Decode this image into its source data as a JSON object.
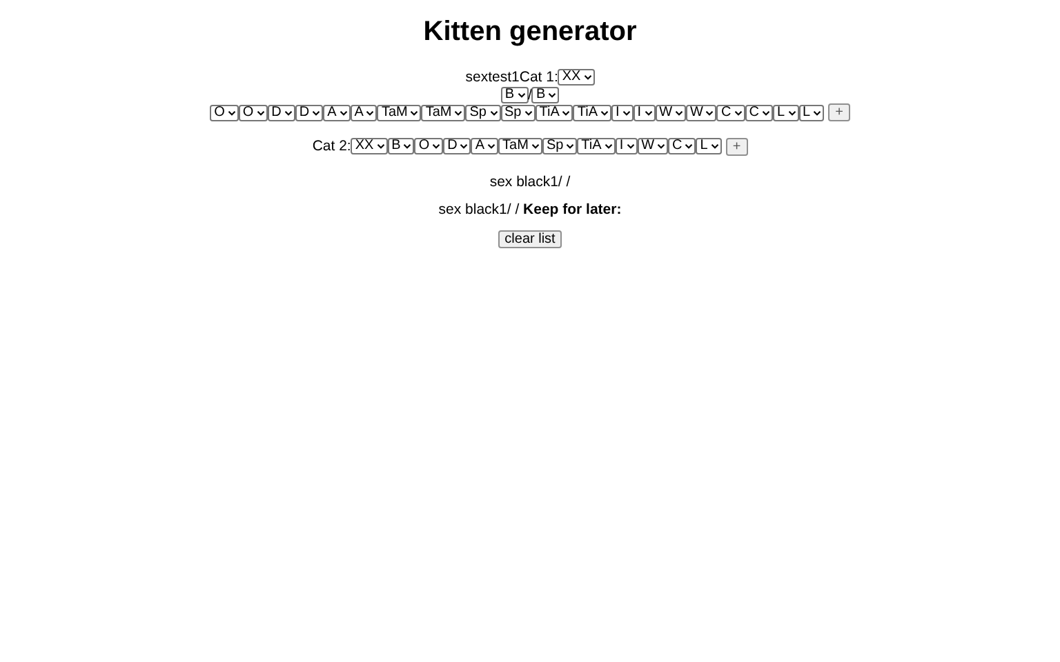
{
  "title": "Kitten generator",
  "cat1": {
    "prefix": "sextest1",
    "label": "Cat 1:",
    "sex": "XX",
    "black": [
      "B",
      "B"
    ],
    "separator": "/",
    "genes": [
      "O",
      "O",
      "D",
      "D",
      "A",
      "A",
      "TaM",
      "TaM",
      "Sp",
      "Sp",
      "TiA",
      "TiA",
      "I",
      "I",
      "W",
      "W",
      "C",
      "C",
      "L",
      "L"
    ],
    "add_button": "+"
  },
  "cat2": {
    "label": "Cat 2:",
    "genes": [
      "XX",
      "B",
      "O",
      "D",
      "A",
      "TaM",
      "Sp",
      "TiA",
      "I",
      "W",
      "C",
      "L"
    ],
    "add_button": "+"
  },
  "result_line": "sex black1/ /",
  "keep_line": {
    "text": "sex black1/ /",
    "bold": "Keep for later:"
  },
  "clear_button": "clear list"
}
